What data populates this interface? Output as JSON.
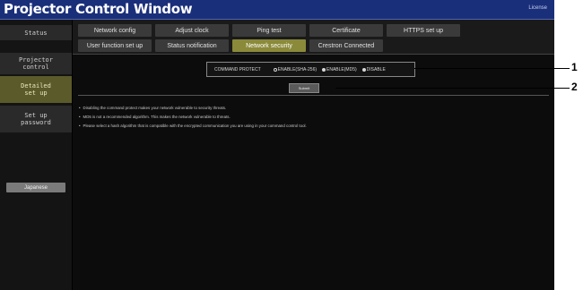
{
  "window": {
    "title": "Projector Control Window",
    "license": "License"
  },
  "sidebar": {
    "items": [
      {
        "label": "Status"
      },
      {
        "label": "Projector\ncontrol"
      },
      {
        "label": "Detailed\nset up"
      },
      {
        "label": "Set up\npassword"
      }
    ],
    "language_button": "Japanese"
  },
  "tabs": [
    {
      "label": "Network config"
    },
    {
      "label": "Adjust clock"
    },
    {
      "label": "Ping test"
    },
    {
      "label": "Certificate"
    },
    {
      "label": "HTTPS set up"
    },
    {
      "label": "User function set up"
    },
    {
      "label": "Status notification"
    },
    {
      "label": "Network security"
    },
    {
      "label": "Crestron Connected"
    }
  ],
  "protect": {
    "label": "COMMAND PROTECT",
    "options": [
      {
        "label": "ENABLE(SHA-256)",
        "selected": true
      },
      {
        "label": "ENABLE(MD5)",
        "selected": false
      },
      {
        "label": "DISABLE",
        "selected": false
      }
    ],
    "submit": "Submit"
  },
  "notes": [
    "Disabling the command protect makes your network vulnerable to security threats.",
    "MD5 is not a recommended algorithm. This makes the network vulnerable to threats.",
    "Please select a hash algorithm that is compatible with the encrypted communication you are using in your command control tool."
  ],
  "callouts": [
    "1",
    "2"
  ]
}
